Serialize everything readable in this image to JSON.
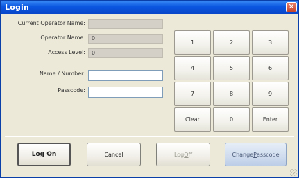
{
  "window": {
    "title": "Login"
  },
  "fields": {
    "current_operator_label": "Current Operator Name:",
    "current_operator_value": "",
    "operator_name_label": "Operator Name:",
    "operator_name_value": "0",
    "access_level_label": "Access Level:",
    "access_level_value": "0",
    "name_number_label": "Name / Number:",
    "name_number_value": "",
    "passcode_label": "Passcode:",
    "passcode_value": ""
  },
  "keypad": {
    "keys": [
      "1",
      "2",
      "3",
      "4",
      "5",
      "6",
      "7",
      "8",
      "9",
      "Clear",
      "0",
      "Enter"
    ]
  },
  "buttons": {
    "log_on": "Log On",
    "cancel": "Cancel",
    "log_off_prefix": "Log ",
    "log_off_mnemonic": "O",
    "log_off_suffix": "ff",
    "change_prefix": "Change ",
    "change_mnemonic": "P",
    "change_suffix": "asscode"
  },
  "icons": {
    "close": "close-icon",
    "resize": "resize-grip-icon"
  }
}
